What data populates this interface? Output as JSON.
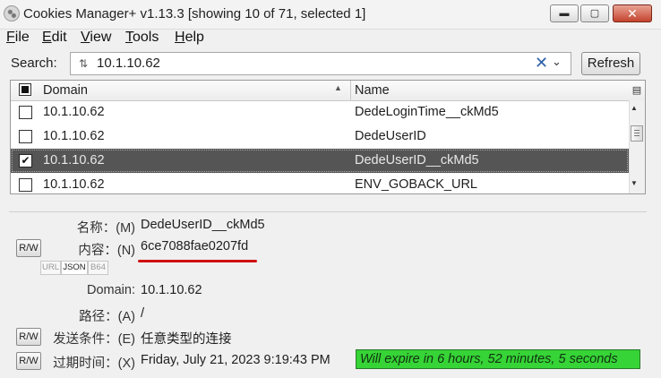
{
  "window": {
    "title": "Cookies Manager+ v1.13.3 [showing 10 of 71, selected 1]",
    "minimize": "▬",
    "maximize": "▢",
    "close": "✕"
  },
  "menu": [
    {
      "key": "F",
      "rest": "ile"
    },
    {
      "key": "E",
      "rest": "dit"
    },
    {
      "key": "V",
      "rest": "iew"
    },
    {
      "key": "T",
      "rest": "ools"
    },
    {
      "key": "H",
      "rest": "elp"
    }
  ],
  "search": {
    "label": "Search:",
    "value": "10.1.10.62",
    "refresh_label": "Refresh"
  },
  "table": {
    "columns": {
      "domain": "Domain",
      "name": "Name"
    },
    "sort_indicator": "▲",
    "rows": [
      {
        "checked": false,
        "domain": "10.1.10.62",
        "name": "DedeLoginTime__ckMd5",
        "selected": false
      },
      {
        "checked": false,
        "domain": "10.1.10.62",
        "name": "DedeUserID",
        "selected": false
      },
      {
        "checked": true,
        "domain": "10.1.10.62",
        "name": "DedeUserID__ckMd5",
        "selected": true
      },
      {
        "checked": false,
        "domain": "10.1.10.62",
        "name": "ENV_GOBACK_URL",
        "selected": false
      }
    ]
  },
  "details": {
    "name_label": "名称：(M)",
    "name_value": "DedeUserID__ckMd5",
    "content_label": "内容：(N)",
    "content_value": "6ce7088fae0207fd",
    "rw_label": "R/W",
    "formats": [
      "URL",
      "JSON",
      "B64"
    ],
    "domain_label": "Domain:",
    "domain_value": "10.1.10.62",
    "path_label": "路径：(A)",
    "path_value": "/",
    "send_label": "发送条件：(E)",
    "send_value": "任意类型的连接",
    "expires_label": "过期时间：(X)",
    "expires_value": "Friday, July 21, 2023 9:19:43 PM",
    "expiry_text": "Will expire in 6 hours, 52 minutes, 5 seconds",
    "expiry_fraction": 1.0
  },
  "colors": {
    "selected_row": "#555555",
    "expiry_bar": "#36d436",
    "annotation": "#d01010"
  }
}
